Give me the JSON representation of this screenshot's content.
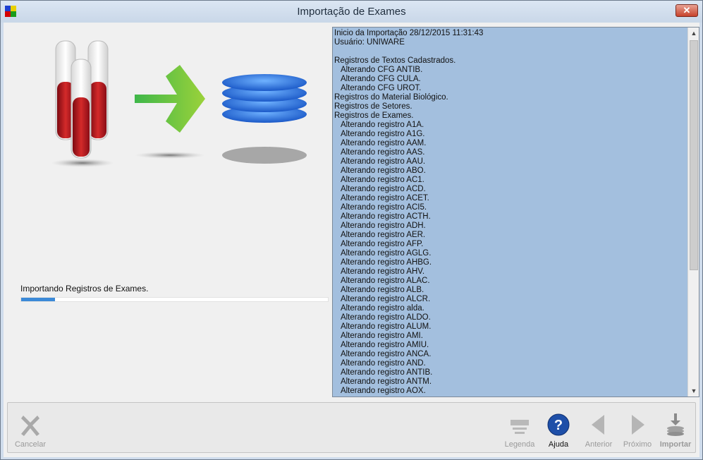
{
  "window": {
    "title": "Importação de Exames",
    "close_label": "✕"
  },
  "status": {
    "message": "Importando Registros de Exames.",
    "progress_fraction": 0.11
  },
  "log": {
    "lines": [
      "Inicio da Importação 28/12/2015 11:31:43",
      "Usuário: UNIWARE",
      "",
      "Registros de Textos Cadastrados.",
      "   Alterando CFG ANTIB.",
      "   Alterando CFG CULA.",
      "   Alterando CFG UROT.",
      "Registros do Material Biológico.",
      "Registros de Setores.",
      "Registros de Exames.",
      "   Alterando registro A1A.",
      "   Alterando registro A1G.",
      "   Alterando registro AAM.",
      "   Alterando registro AAS.",
      "   Alterando registro AAU.",
      "   Alterando registro ABO.",
      "   Alterando registro AC1.",
      "   Alterando registro ACD.",
      "   Alterando registro ACET.",
      "   Alterando registro ACI5.",
      "   Alterando registro ACTH.",
      "   Alterando registro ADH.",
      "   Alterando registro AER.",
      "   Alterando registro AFP.",
      "   Alterando registro AGLG.",
      "   Alterando registro AHBG.",
      "   Alterando registro AHV.",
      "   Alterando registro ALAC.",
      "   Alterando registro ALB.",
      "   Alterando registro ALCR.",
      "   Alterando registro alda.",
      "   Alterando registro ALDO.",
      "   Alterando registro ALUM.",
      "   Alterando registro AMI.",
      "   Alterando registro AMIU.",
      "   Alterando registro ANCA.",
      "   Alterando registro AND.",
      "   Alterando registro ANTIB.",
      "   Alterando registro ANTM.",
      "   Alterando registro AOX."
    ]
  },
  "footer": {
    "cancel_label": "Cancelar",
    "legend_label": "Legenda",
    "help_label": "Ajuda",
    "prev_label": "Anterior",
    "next_label": "Próximo",
    "import_label": "Importar"
  },
  "colors": {
    "log_bg": "#a3bfde",
    "progress": "#3c8ad8",
    "help_blue": "#1e4fa8"
  }
}
